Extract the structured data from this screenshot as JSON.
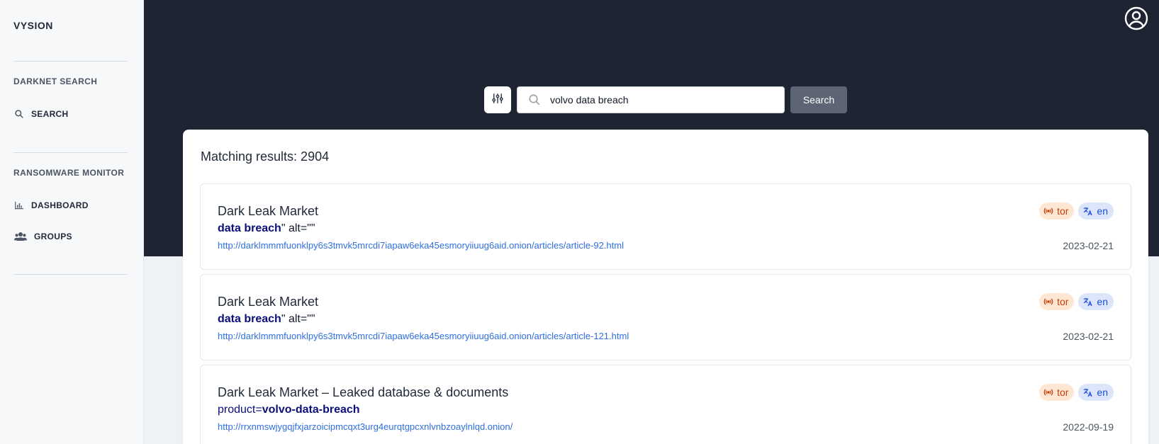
{
  "sidebar": {
    "brand": "VYSION",
    "sections": [
      {
        "title": "DARKNET SEARCH",
        "items": [
          {
            "label": "SEARCH",
            "icon": "search-icon"
          }
        ]
      },
      {
        "title": "RANSOMWARE MONITOR",
        "items": [
          {
            "label": "DASHBOARD",
            "icon": "chart-icon"
          },
          {
            "label": "GROUPS",
            "icon": "users-icon"
          }
        ]
      }
    ]
  },
  "header": {
    "profile_icon": "user-circle-icon"
  },
  "search": {
    "filter_icon": "sliders-icon",
    "query": "volvo data breach",
    "button_label": "Search"
  },
  "results": {
    "count_label": "Matching results: 2904",
    "items": [
      {
        "title": "Dark Leak Market",
        "snippet_prefix": "",
        "snippet_highlight": "data breach",
        "snippet_suffix": "\" alt=\"\"",
        "url": "http://darklmmmfuonklpy6s3tmvk5mrcdi7iapaw6eka45esmoryiiuug6aid.onion/articles/article-92.html",
        "date": "2023-02-21",
        "network": "tor",
        "language": "en"
      },
      {
        "title": "Dark Leak Market",
        "snippet_prefix": "",
        "snippet_highlight": "data breach",
        "snippet_suffix": "\" alt=\"\"",
        "url": "http://darklmmmfuonklpy6s3tmvk5mrcdi7iapaw6eka45esmoryiiuug6aid.onion/articles/article-121.html",
        "date": "2023-02-21",
        "network": "tor",
        "language": "en"
      },
      {
        "title": "Dark Leak Market – Leaked database & documents",
        "snippet_prefix": "product=",
        "snippet_highlight": "volvo-data-breach",
        "snippet_suffix": "",
        "url": "http://rrxnmswjygqjfxjarzoicipmcqxt3urg4eurqtgpcxnlvnbzoaylnlqd.onion/",
        "date": "2022-09-19",
        "network": "tor",
        "language": "en"
      }
    ]
  },
  "colors": {
    "header_bg": "#1f2433",
    "highlight": "#0b0f7a",
    "link": "#2f6fde",
    "tor_badge_bg": "#fde7d2",
    "lang_badge_bg": "#dbe6fb"
  }
}
